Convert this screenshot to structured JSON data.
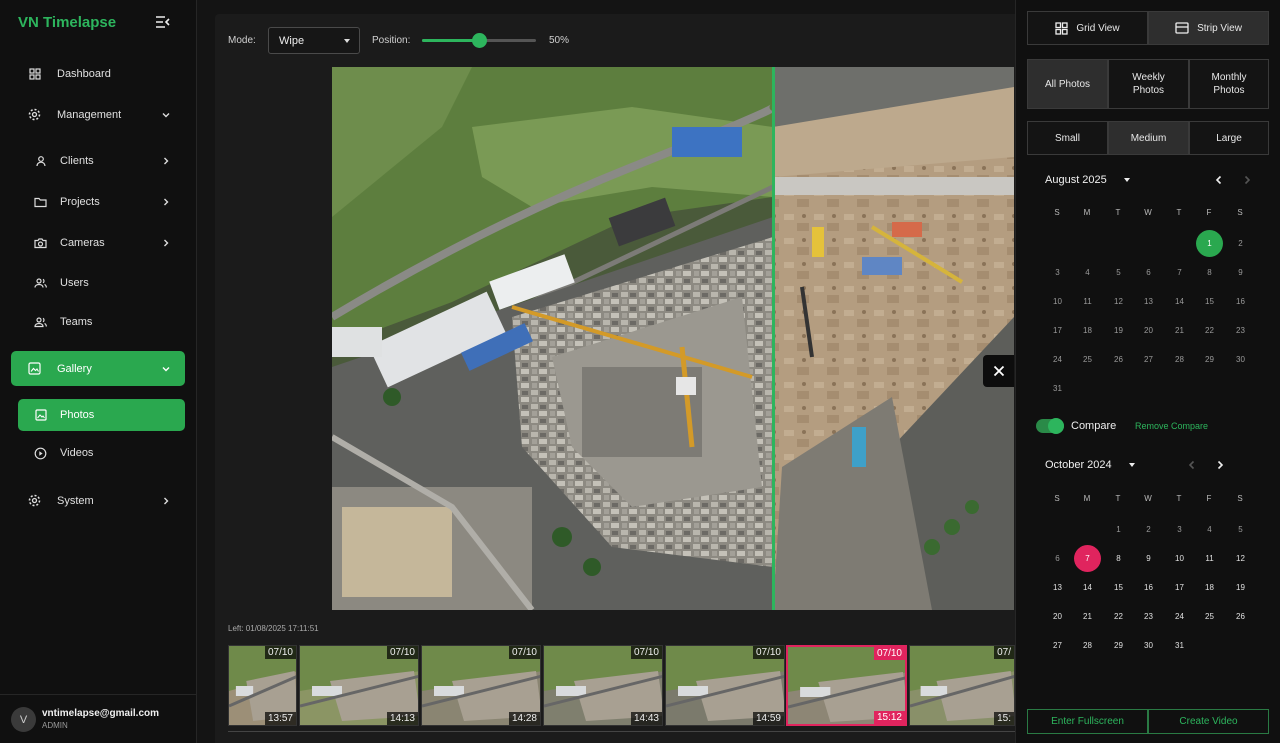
{
  "sidebar": {
    "brand": "VN Timelapse",
    "items": [
      {
        "label": "Dashboard",
        "icon": "dashboard-icon"
      },
      {
        "label": "Management",
        "icon": "gear-icon"
      },
      {
        "label": "Clients",
        "icon": "user-icon"
      },
      {
        "label": "Projects",
        "icon": "folder-icon"
      },
      {
        "label": "Cameras",
        "icon": "camera-icon"
      },
      {
        "label": "Users",
        "icon": "users-icon"
      },
      {
        "label": "Teams",
        "icon": "team-icon"
      },
      {
        "label": "Gallery",
        "icon": "gallery-icon"
      },
      {
        "label": "Photos",
        "icon": "image-icon"
      },
      {
        "label": "Videos",
        "icon": "play-circle-icon"
      },
      {
        "label": "System",
        "icon": "gear-icon"
      }
    ],
    "user": {
      "initial": "V",
      "email": "vntimelapse@gmail.com",
      "role": "ADMIN"
    }
  },
  "toolbar": {
    "mode_label": "Mode:",
    "mode_value": "Wipe",
    "position_label": "Position:",
    "position_value": "50%",
    "position_fraction": 0.5
  },
  "viewer": {
    "left_info": "Left: 01/08/2025 17:11:51"
  },
  "thumbnails": [
    {
      "date": "07/10",
      "time": "13:57"
    },
    {
      "date": "07/10",
      "time": "14:13"
    },
    {
      "date": "07/10",
      "time": "14:28"
    },
    {
      "date": "07/10",
      "time": "14:43"
    },
    {
      "date": "07/10",
      "time": "14:59"
    },
    {
      "date": "07/10",
      "time": "15:12",
      "selected": true
    },
    {
      "date": "07/",
      "time": "15:"
    }
  ],
  "panel": {
    "views": [
      "Grid View",
      "Strip View"
    ],
    "active_view": 1,
    "photo_filters": [
      "All Photos",
      "Weekly Photos",
      "Monthly Photos"
    ],
    "active_filter": 0,
    "sizes": [
      "Small",
      "Medium",
      "Large"
    ],
    "active_size": 1,
    "dow": [
      "S",
      "M",
      "T",
      "W",
      "T",
      "F",
      "S"
    ],
    "cal1": {
      "title": "August 2025",
      "first_dow": 5,
      "days": 31,
      "selected": 1,
      "available_up_to": 1
    },
    "cal2": {
      "title": "October 2024",
      "first_dow": 2,
      "days": 31,
      "selected": 7,
      "available_from": 7
    },
    "compare_label": "Compare",
    "remove_compare_label": "Remove Compare",
    "fullscreen_label": "Enter Fullscreen",
    "create_video_label": "Create Video"
  },
  "colors": {
    "accent": "#2db55d",
    "selected_pink": "#e0245e"
  }
}
